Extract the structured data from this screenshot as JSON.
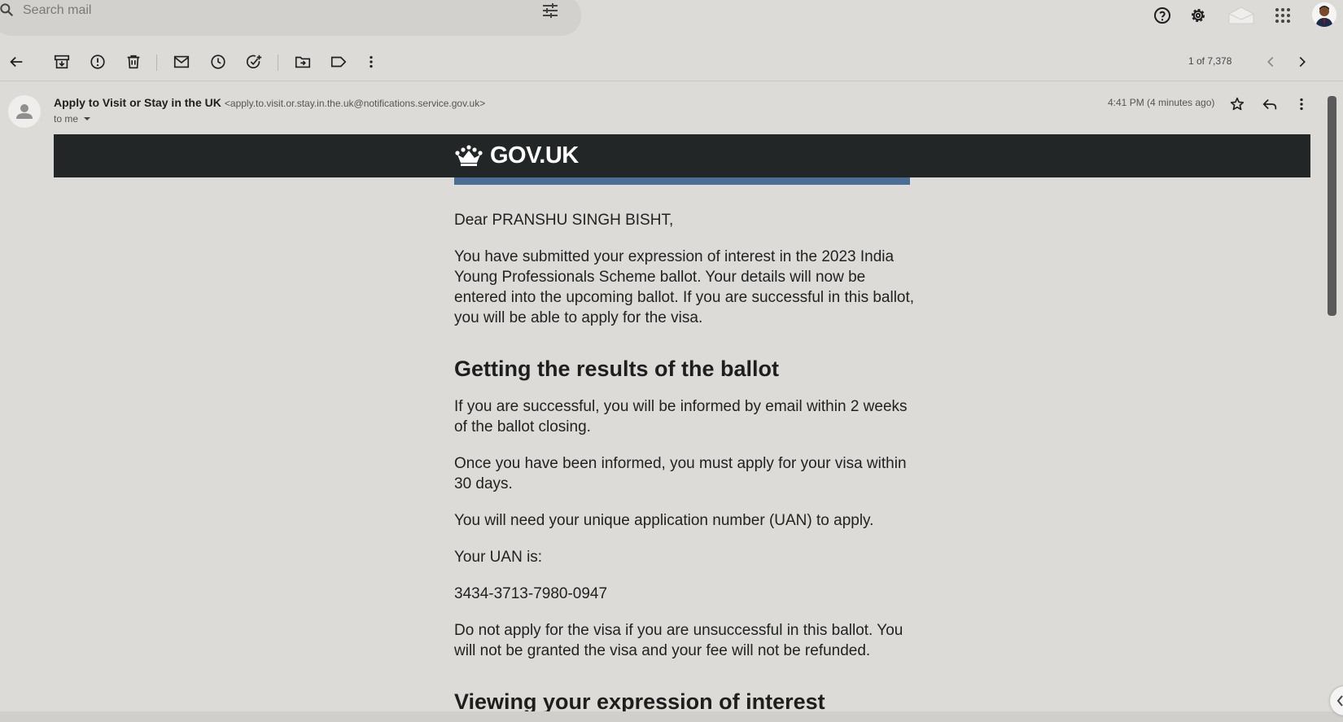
{
  "search": {
    "placeholder": "Search mail"
  },
  "toolbar": {
    "pager": "1 of 7,378"
  },
  "message": {
    "sender_name": "Apply to Visit or Stay in the UK",
    "sender_email": "<apply.to.visit.or.stay.in.the.uk@notifications.service.gov.uk>",
    "recipient": "to me",
    "time": "4:41 PM (4 minutes ago)"
  },
  "banner": {
    "logo_text": "GOV.UK"
  },
  "body": {
    "greeting": "Dear PRANSHU SINGH BISHT,",
    "para1": "You have submitted your expression of interest in the 2023 India Young Professionals Scheme ballot. Your details will now be entered into the upcoming ballot. If you are successful in this ballot, you will be able to apply for the visa.",
    "heading1": "Getting the results of the ballot",
    "para2": "If you are successful, you will be informed by email within 2 weeks of the ballot closing.",
    "para3": "Once you have been informed, you must apply for your visa within 30 days.",
    "para4": "You will need your unique application number (UAN) to apply.",
    "para5": "Your UAN is:",
    "uan": "3434-3713-7980-0947",
    "para6": "Do not apply for the visa if you are unsuccessful in this ballot. You will not be granted the visa and your fee will not be refunded.",
    "heading2": "Viewing your expression of interest"
  },
  "colors": {
    "banner": "#222626",
    "stripe": "#4c6e94",
    "background": "#dcdbd8"
  },
  "icons": [
    "search-icon",
    "filter-icon",
    "help-icon",
    "settings-icon",
    "mail-app-icon",
    "apps-grid-icon",
    "back-arrow-icon",
    "archive-icon",
    "report-spam-icon",
    "delete-icon",
    "mark-unread-icon",
    "snooze-icon",
    "add-task-icon",
    "move-to-icon",
    "label-icon",
    "more-vert-icon",
    "chevron-left-icon",
    "chevron-right-icon",
    "star-icon",
    "reply-icon",
    "crown-icon"
  ]
}
